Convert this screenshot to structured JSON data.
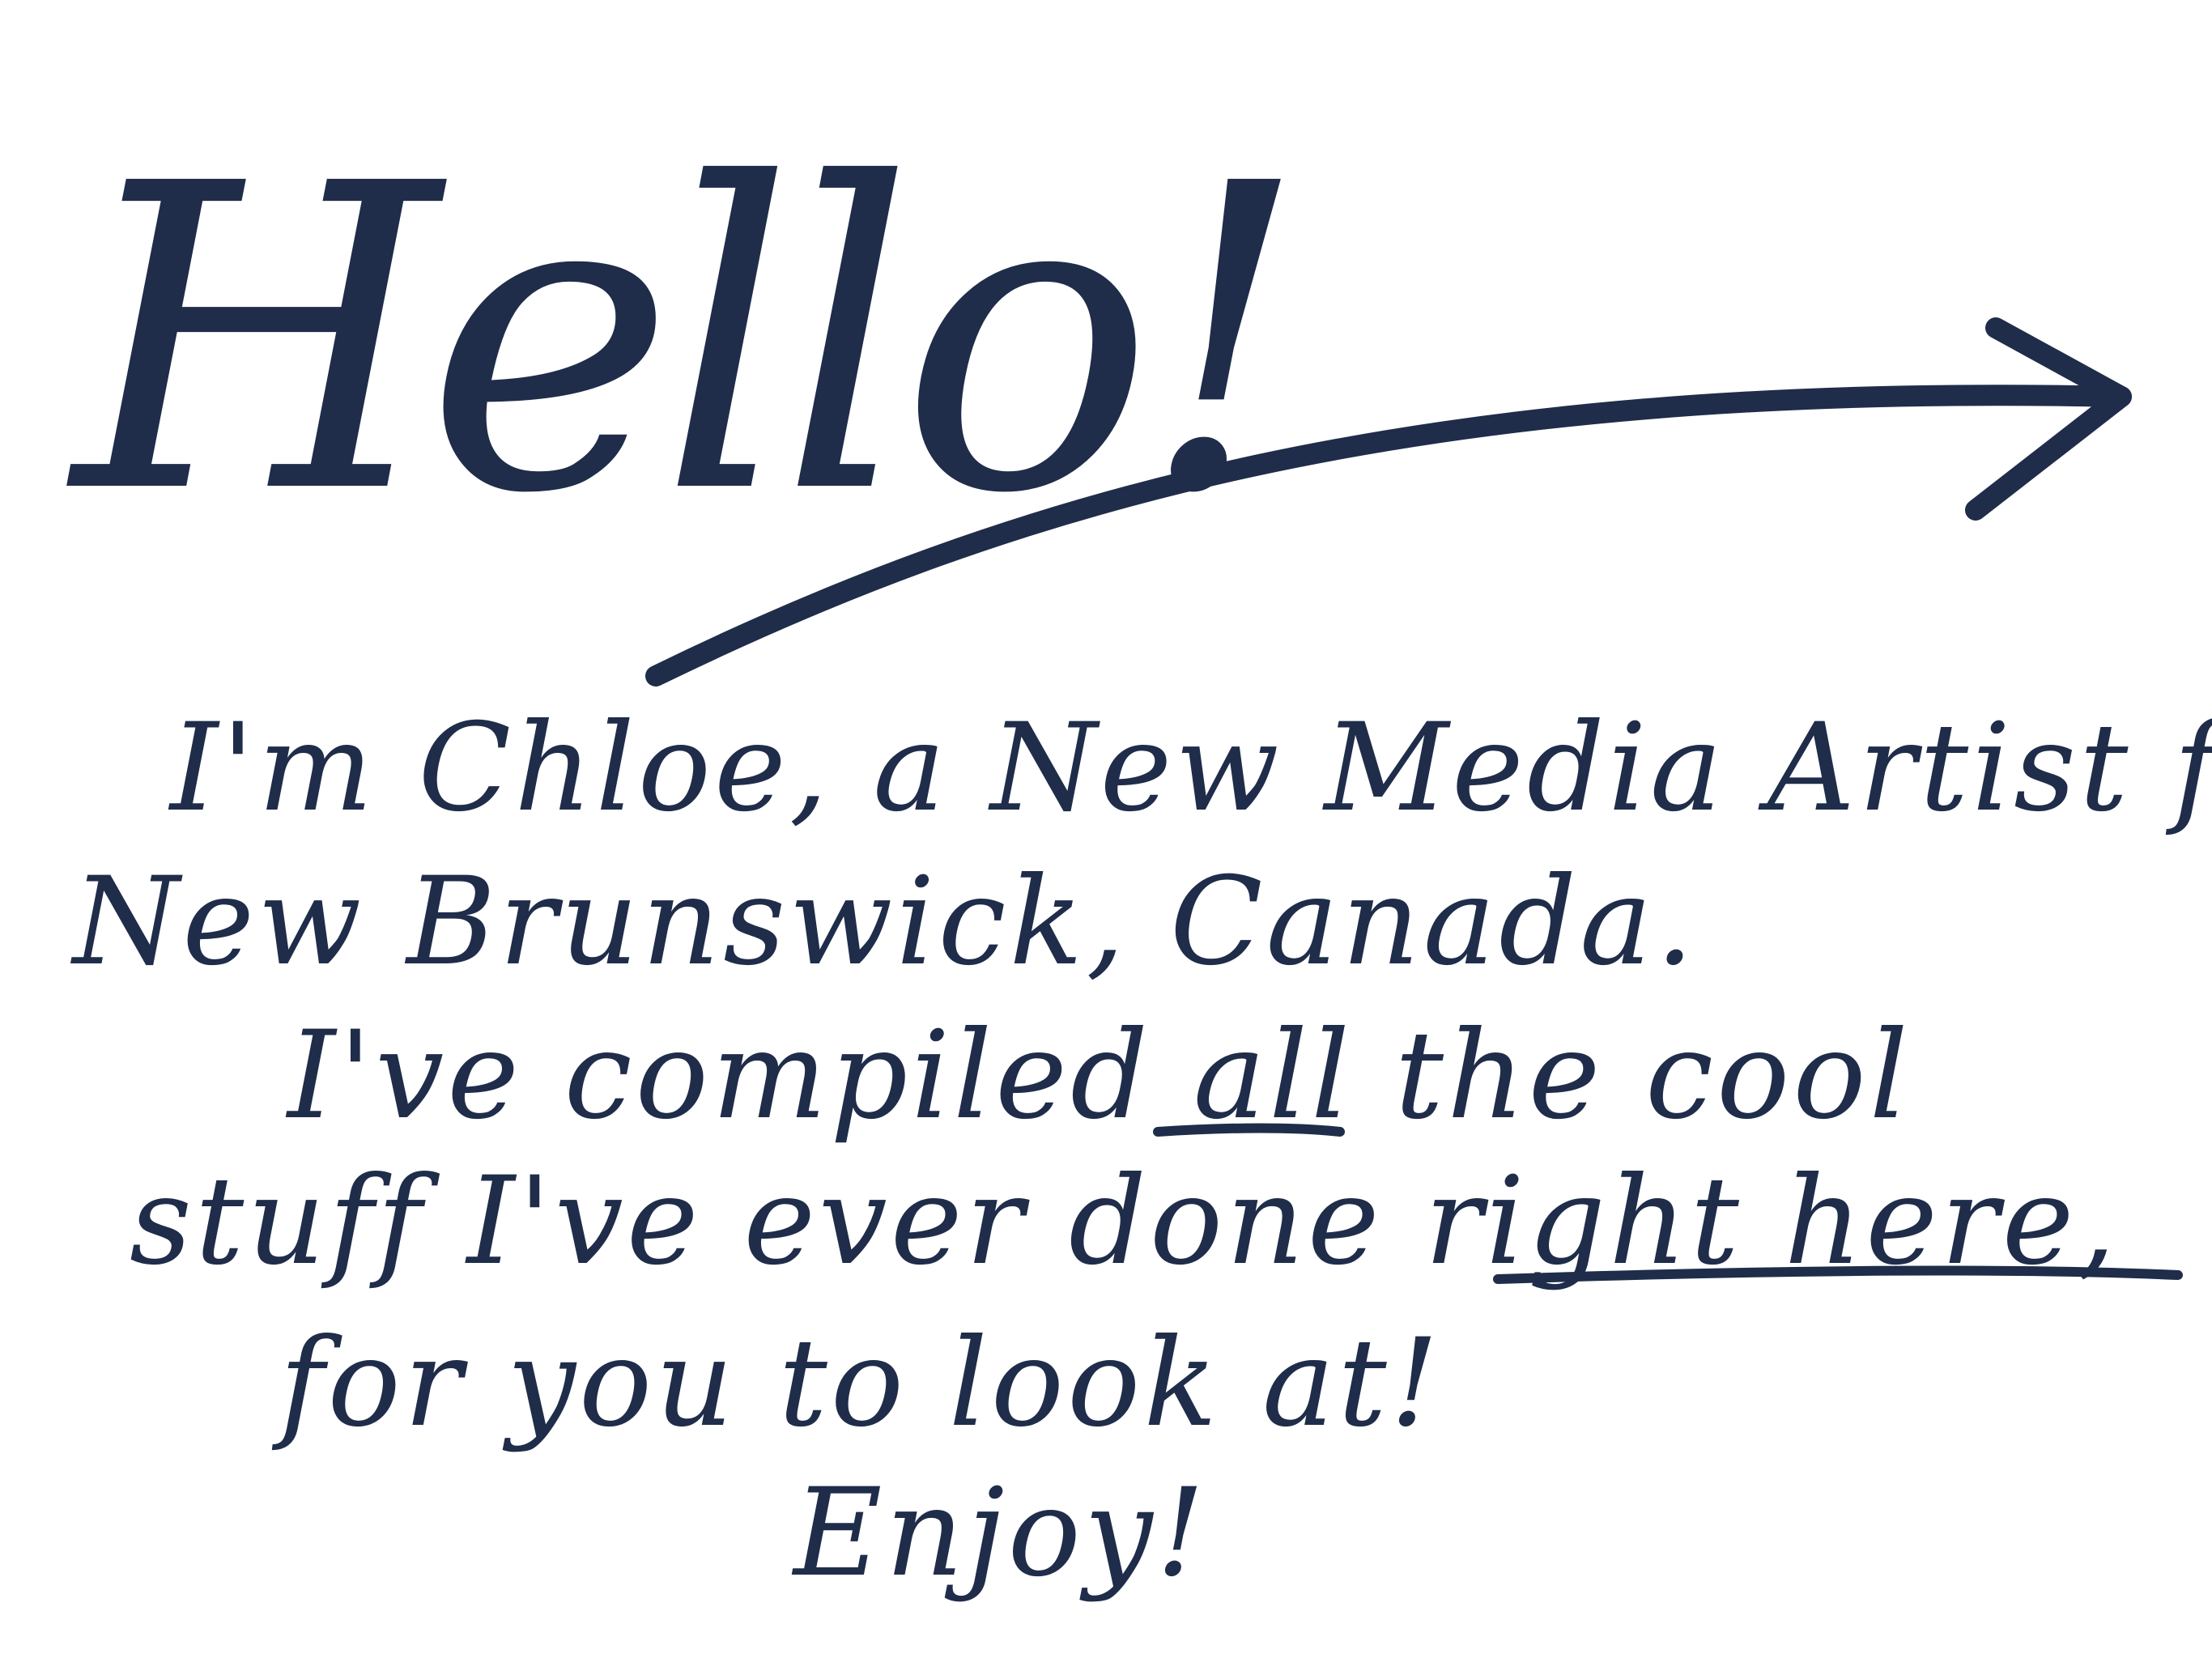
{
  "note": {
    "greeting": "Hello!",
    "lines": [
      "I'm Chloe, a New Media Artist from",
      "New Brunswick, Canada.",
      "I've compiled all the cool",
      "stuff I've ever done right here,",
      "for you to look at!",
      "Enjoy!"
    ],
    "underlined_words": [
      "all",
      "right here"
    ],
    "ink_color": "#1f2d4a",
    "arrow_icon": "curved-right-arrow-icon"
  }
}
